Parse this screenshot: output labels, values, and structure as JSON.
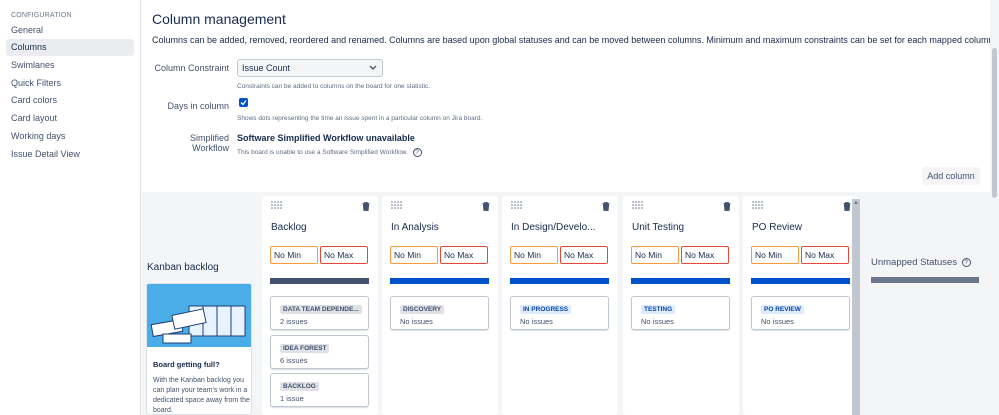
{
  "sidebar": {
    "heading": "CONFIGURATION",
    "items": [
      {
        "label": "General"
      },
      {
        "label": "Columns"
      },
      {
        "label": "Swimlanes"
      },
      {
        "label": "Quick Filters"
      },
      {
        "label": "Card colors"
      },
      {
        "label": "Card layout"
      },
      {
        "label": "Working days"
      },
      {
        "label": "Issue Detail View"
      }
    ]
  },
  "header": {
    "title": "Column management",
    "description": "Columns can be added, removed, reordered and renamed. Columns are based upon global statuses and can be moved between columns. Minimum and maximum constraints can be set for each mapped column."
  },
  "settings": {
    "constraint_label": "Column Constraint",
    "constraint_value": "Issue Count",
    "constraint_hint": "Constraints can be added to columns on the board for one statistic.",
    "days_label": "Days in column",
    "days_hint": "Shows dots representing the time an issue spent in a particular column on Jira board.",
    "workflow_label": "Simplified Workflow",
    "workflow_value": "Software Simplified Workflow unavailable",
    "workflow_hint": "This board is unable to use a Software Simplified Workflow."
  },
  "toolbar": {
    "add_column_label": "Add column"
  },
  "kanban_backlog": {
    "title": "Kanban backlog",
    "promo_title": "Board getting full?",
    "promo_text": "With the Kanban backlog you can plan your team's work in a dedicated space away from the board."
  },
  "columns": [
    {
      "title": "Backlog",
      "min": "No Min",
      "max": "No Max",
      "bar_color": "#42526e",
      "statuses": [
        {
          "name": "DATA TEAM DEPENDE...",
          "count": "2 issues",
          "style": "grey"
        },
        {
          "name": "IDEA FOREST",
          "count": "6 issues",
          "style": "grey"
        },
        {
          "name": "BACKLOG",
          "count": "1 issue",
          "style": "grey"
        }
      ]
    },
    {
      "title": "In Analysis",
      "min": "No Min",
      "max": "No Max",
      "bar_color": "#0052cc",
      "statuses": [
        {
          "name": "DISCOVERY",
          "count": "No issues",
          "style": "grey"
        }
      ]
    },
    {
      "title": "In Design/Develo...",
      "min": "No Min",
      "max": "No Max",
      "bar_color": "#0052cc",
      "statuses": [
        {
          "name": "IN PROGRESS",
          "count": "No issues",
          "style": "blue"
        }
      ]
    },
    {
      "title": "Unit Testing",
      "min": "No Min",
      "max": "No Max",
      "bar_color": "#0052cc",
      "statuses": [
        {
          "name": "TESTING",
          "count": "No issues",
          "style": "blue"
        }
      ]
    },
    {
      "title": "PO Review",
      "min": "No Min",
      "max": "No Max",
      "bar_color": "#0052cc",
      "statuses": [
        {
          "name": "PO REVIEW",
          "count": "No issues",
          "style": "blue"
        }
      ]
    }
  ],
  "unmapped": {
    "title": "Unmapped Statuses"
  },
  "icons": {
    "help": "?",
    "chevron": "⌄"
  }
}
